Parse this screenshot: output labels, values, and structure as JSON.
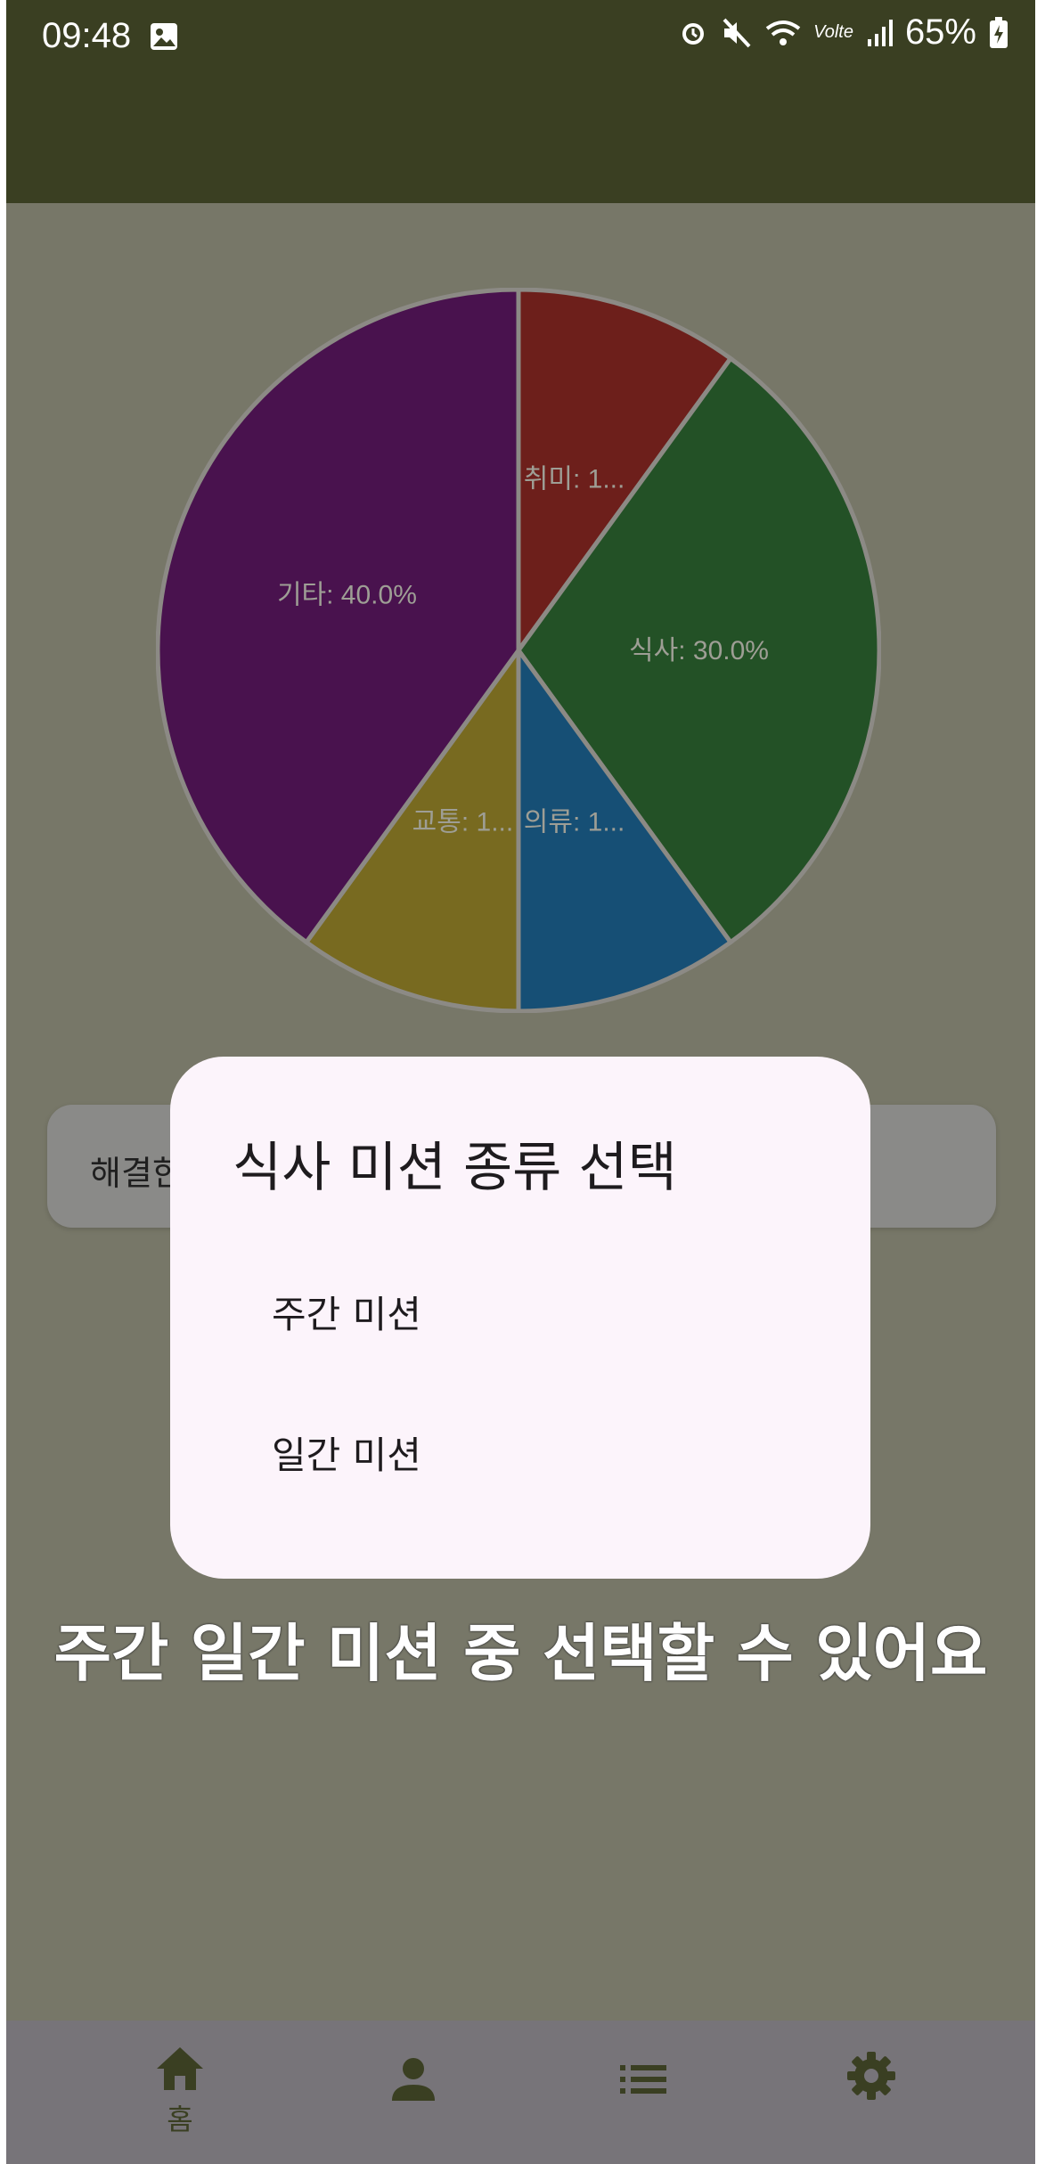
{
  "status_bar": {
    "time": "09:48",
    "battery": "65%",
    "network": "Volte"
  },
  "chart_data": {
    "type": "pie",
    "slices": [
      {
        "label": "취미: 1...",
        "value": 10.0,
        "color": "#6d1f1b"
      },
      {
        "label": "식사: 30.0%",
        "value": 30.0,
        "color": "#235126"
      },
      {
        "label": "의류: 1...",
        "value": 10.0,
        "color": "#164f75"
      },
      {
        "label": "교통: 1...",
        "value": 10.0,
        "color": "#786a20"
      },
      {
        "label": "기타: 40.0%",
        "value": 40.0,
        "color": "#49124e"
      }
    ]
  },
  "card": {
    "text": "해결한"
  },
  "dialog": {
    "title": "식사 미션 종류 선택",
    "options": [
      "주간 미션",
      "일간 미션"
    ]
  },
  "caption": "주간 일간 미션 중 선택할  수 있어요",
  "fab": {
    "label": "+"
  },
  "nav": {
    "items": [
      {
        "icon": "home-icon",
        "label": "홈"
      },
      {
        "icon": "person-icon",
        "label": ""
      },
      {
        "icon": "list-icon",
        "label": ""
      },
      {
        "icon": "gear-icon",
        "label": ""
      }
    ]
  },
  "colors": {
    "primary": "#3a3f22",
    "scrim_background": "#777768",
    "dialog_background": "#fcf4fb"
  }
}
